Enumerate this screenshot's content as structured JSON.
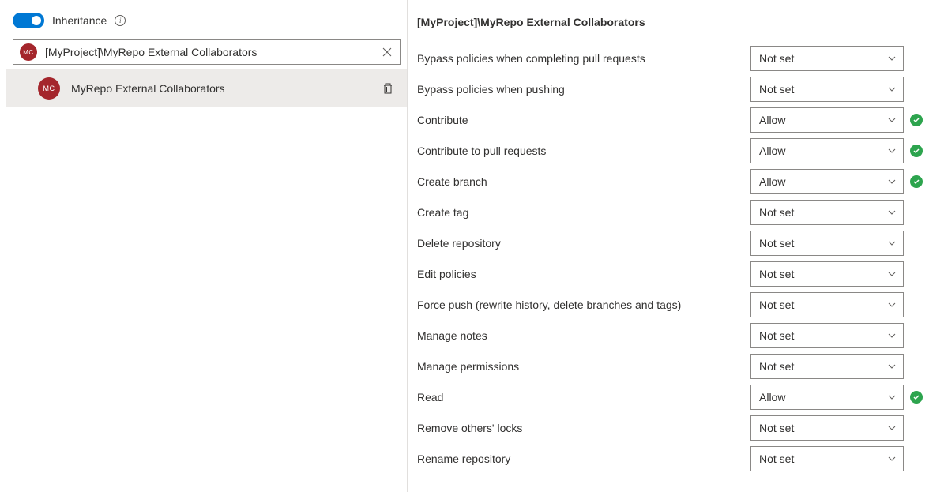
{
  "inheritance": {
    "label": "Inheritance",
    "enabled": true
  },
  "search": {
    "value": "[MyProject]\\MyRepo External Collaborators",
    "avatar_initials": "MC"
  },
  "groups": [
    {
      "avatar_initials": "MC",
      "name": "MyRepo External Collaborators"
    }
  ],
  "details": {
    "title": "[MyProject]\\MyRepo External Collaborators",
    "permissions": [
      {
        "label": "Bypass policies when completing pull requests",
        "value": "Not set",
        "check": false
      },
      {
        "label": "Bypass policies when pushing",
        "value": "Not set",
        "check": false
      },
      {
        "label": "Contribute",
        "value": "Allow",
        "check": true
      },
      {
        "label": "Contribute to pull requests",
        "value": "Allow",
        "check": true
      },
      {
        "label": "Create branch",
        "value": "Allow",
        "check": true
      },
      {
        "label": "Create tag",
        "value": "Not set",
        "check": false
      },
      {
        "label": "Delete repository",
        "value": "Not set",
        "check": false
      },
      {
        "label": "Edit policies",
        "value": "Not set",
        "check": false
      },
      {
        "label": "Force push (rewrite history, delete branches and tags)",
        "value": "Not set",
        "check": false
      },
      {
        "label": "Manage notes",
        "value": "Not set",
        "check": false
      },
      {
        "label": "Manage permissions",
        "value": "Not set",
        "check": false
      },
      {
        "label": "Read",
        "value": "Allow",
        "check": true
      },
      {
        "label": "Remove others' locks",
        "value": "Not set",
        "check": false
      },
      {
        "label": "Rename repository",
        "value": "Not set",
        "check": false
      }
    ]
  }
}
